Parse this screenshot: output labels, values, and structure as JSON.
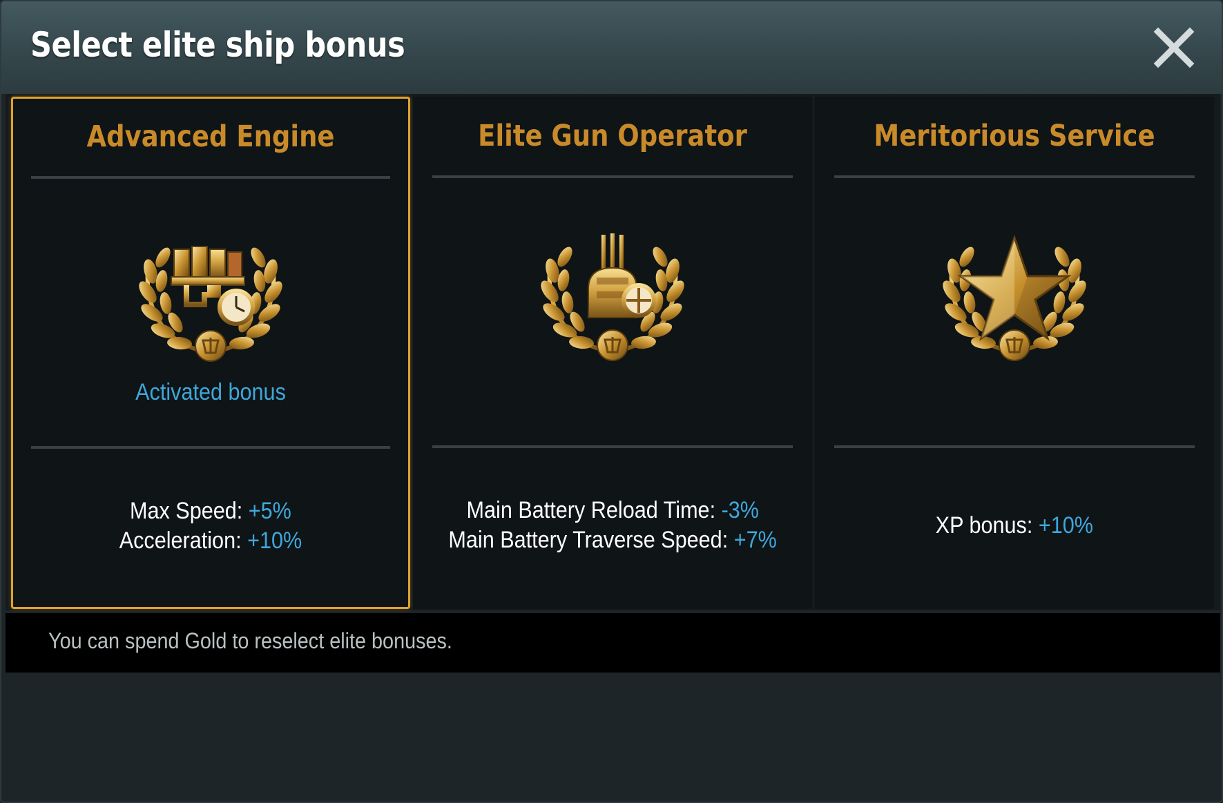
{
  "dialog": {
    "title": "Select elite ship bonus",
    "close_icon": "close-icon"
  },
  "cards": [
    {
      "name": "Advanced Engine",
      "icon": "engine-laurel-emblem-icon",
      "status": "Activated bonus",
      "selected": true,
      "effects": [
        {
          "label": "Max Speed: ",
          "value": "+5%"
        },
        {
          "label": "Acceleration: ",
          "value": "+10%"
        }
      ]
    },
    {
      "name": "Elite Gun Operator",
      "icon": "gun-turret-laurel-emblem-icon",
      "status": "",
      "selected": false,
      "effects": [
        {
          "label": "Main Battery Reload Time: ",
          "value": "-3%"
        },
        {
          "label": "Main Battery Traverse Speed: ",
          "value": "+7%"
        }
      ]
    },
    {
      "name": "Meritorious Service",
      "icon": "star-laurel-emblem-icon",
      "status": "",
      "selected": false,
      "effects": [
        {
          "label": "XP bonus: ",
          "value": "+10%"
        }
      ]
    }
  ],
  "footer": {
    "text": "You can spend Gold to reselect elite bonuses."
  },
  "colors": {
    "title_gold": "#c98a2a",
    "selection_border": "#e0a22d",
    "value_blue": "#3fa7db"
  }
}
